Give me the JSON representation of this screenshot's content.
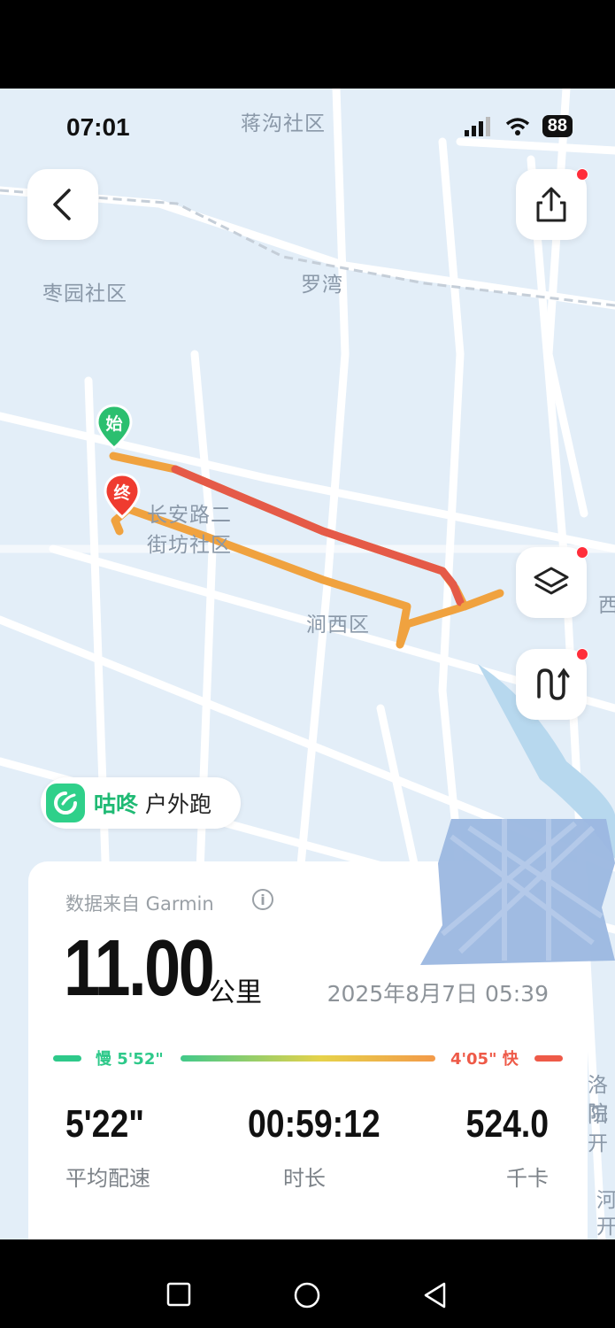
{
  "status_bar": {
    "time": "07:01",
    "battery": "88"
  },
  "map": {
    "labels": [
      "蒋沟社区",
      "枣园社区",
      "罗湾",
      "长安路二",
      "街坊社区",
      "涧西区",
      "西",
      "洛阳",
      "院开",
      "河",
      "开"
    ],
    "start_marker": "始",
    "end_marker": "终",
    "route_colors": {
      "slow": "#f0a23f",
      "fast": "#e2524a"
    }
  },
  "brand": {
    "name": "咕咚",
    "activity": "户外跑",
    "color": "#2fd08a"
  },
  "summary": {
    "source_text": "数据来自 Garmin",
    "distance": "11.00",
    "distance_unit": "公里",
    "datetime": "2025年8月7日 05:39",
    "pace_slow": "慢 5'52\"",
    "pace_fast": "4'05\" 快",
    "stats": [
      {
        "value": "5'22\"",
        "label": "平均配速"
      },
      {
        "value": "00:59:12",
        "label": "时长"
      },
      {
        "value": "524.0",
        "label": "千卡"
      }
    ]
  },
  "icons": [
    "back-icon",
    "share-icon",
    "layers-icon",
    "route-icon",
    "info-icon",
    "brand-logo-icon",
    "signal-icon",
    "wifi-icon",
    "battery-icon",
    "nav-recents-icon",
    "nav-home-icon",
    "nav-back-icon"
  ]
}
